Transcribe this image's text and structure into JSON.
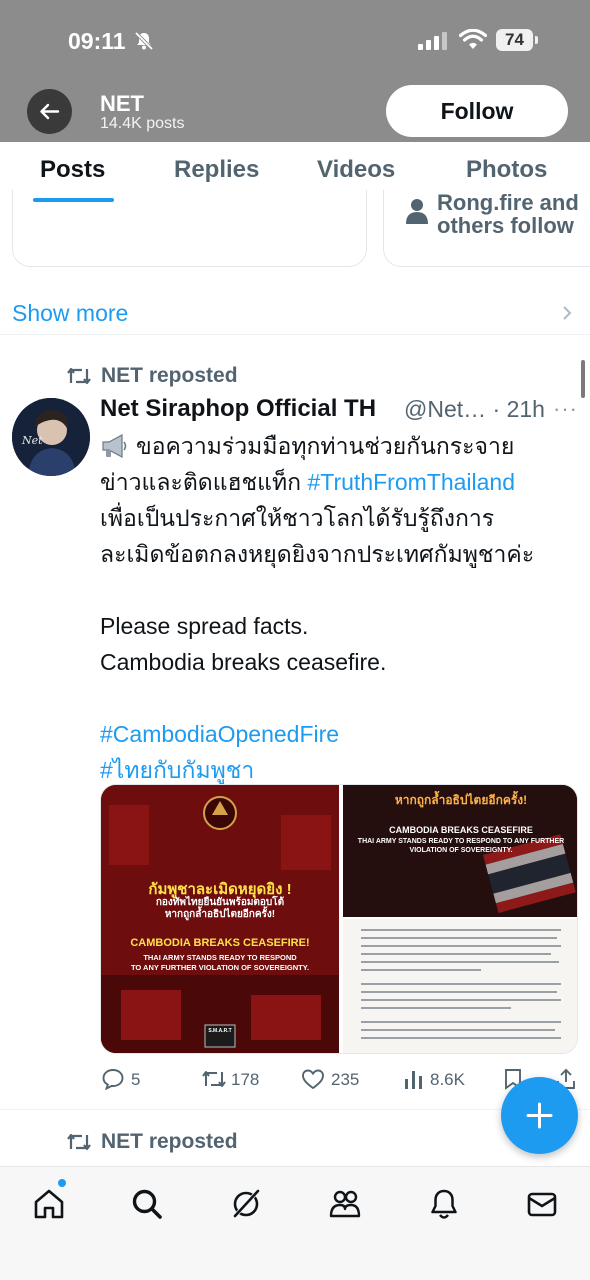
{
  "status_bar": {
    "time": "09:11",
    "battery": "74"
  },
  "header": {
    "name": "NET",
    "posts_count": "14.4K posts",
    "follow_label": "Follow"
  },
  "tabs": [
    {
      "label": "Posts"
    },
    {
      "label": "Replies"
    },
    {
      "label": "Videos"
    },
    {
      "label": "Photos"
    }
  ],
  "suggestion_card": {
    "follow_line1": "Rong.fire and",
    "follow_line2": "others follow"
  },
  "show_more": "Show more",
  "post": {
    "repost_label": "NET reposted",
    "author_name": "Net Siraphop Official TH",
    "handle_time": "@Net… · 21h",
    "more": "···",
    "text_lines": [
      "ขอความร่วมมือทุกท่านช่วยกันกระจาย",
      "ข่าวและติดแฮชแท็ก",
      "#TruthFromThailand",
      "เพื่อเป็นประกาศให้ชาวโลกได้รับรู้ถึงการ",
      "ละเมิดข้อตกลงหยุดยิงจากประเทศกัมพูชาค่ะ",
      "Please spread facts.",
      "Cambodia breaks ceasefire.",
      "#CambodiaOpenedFire",
      "#ไทยกับกัมพูชา"
    ],
    "media": {
      "left_thai_title": "กัมพูชาละเมิดหยุดยิง !",
      "left_thai_sub1": "กองทัพไทยยืนยันพร้อมตอบโต้",
      "left_thai_sub2": "หากถูกล้ำอธิปไตยอีกครั้ง!",
      "left_en_title": "CAMBODIA BREAKS CEASEFIRE!",
      "left_en_sub1": "THAI ARMY STANDS READY TO RESPOND",
      "left_en_sub2": "TO ANY FURTHER VIOLATION OF SOVEREIGNTY.",
      "left_badge": "S.M.A.R.T",
      "right_thai_title": "หากถูกล้ำอธิปไตยอีกครั้ง!",
      "right_en_title": "CAMBODIA BREAKS CEASEFIRE",
      "right_en_sub1": "THAI ARMY STANDS READY TO RESPOND TO ANY FURTHER",
      "right_en_sub2": "VIOLATION OF SOVEREIGNTY."
    },
    "actions": {
      "replies": "5",
      "reposts": "178",
      "likes": "235",
      "views": "8.6K"
    }
  },
  "next_post": {
    "repost_label": "NET reposted"
  },
  "nav": [
    "home-icon",
    "search-icon",
    "grok-icon",
    "communities-icon",
    "notifications-icon",
    "messages-icon"
  ],
  "colors": {
    "accent": "#1d9bf0",
    "header_bg": "#8c8c8c",
    "text_secondary": "#536471"
  }
}
